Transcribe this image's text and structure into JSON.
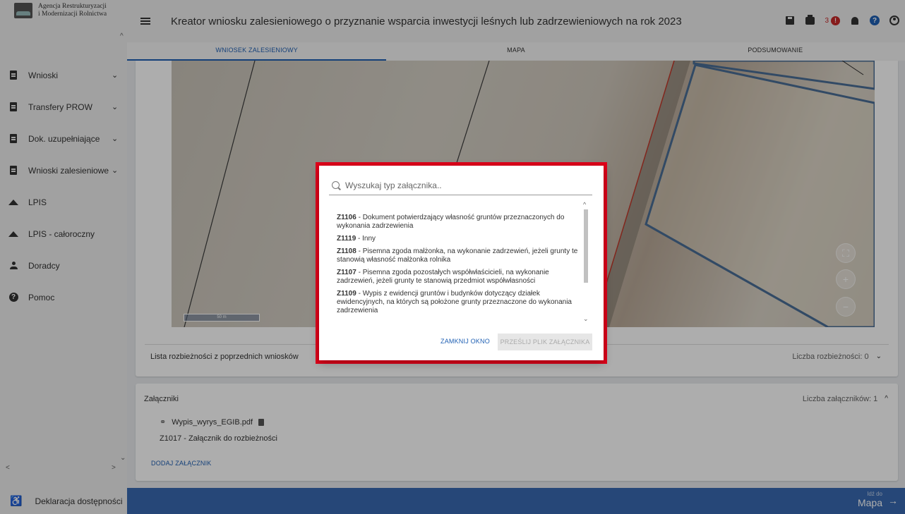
{
  "sidebar": {
    "logo_line1": "Agencja Restrukturyzacji",
    "logo_line2": "i Modernizacji Rolnictwa",
    "items": [
      {
        "label": "Wnioski",
        "icon": "document-icon",
        "expandable": true
      },
      {
        "label": "Transfery PROW",
        "icon": "document-icon",
        "expandable": true
      },
      {
        "label": "Dok. uzupełniające",
        "icon": "document-icon",
        "expandable": true
      },
      {
        "label": "Wnioski zalesieniowe",
        "icon": "document-icon",
        "expandable": true
      },
      {
        "label": "LPIS",
        "icon": "terrain-icon",
        "expandable": false
      },
      {
        "label": "LPIS - całoroczny",
        "icon": "terrain-icon",
        "expandable": false
      },
      {
        "label": "Doradcy",
        "icon": "person-icon",
        "expandable": false
      },
      {
        "label": "Pomoc",
        "icon": "help-icon",
        "expandable": false
      }
    ],
    "accessibility": "Deklaracja dostępności"
  },
  "header": {
    "title": "Kreator wniosku zalesieniowego o przyznanie wsparcia inwestycji leśnych lub zadrzewieniowych na rok 2023",
    "error_count": "3",
    "error_badge": "!",
    "help_glyph": "?"
  },
  "tabs": [
    {
      "label": "WNIOSEK ZALESIENIOWY",
      "active": true
    },
    {
      "label": "MAPA",
      "active": false
    },
    {
      "label": "PODSUMOWANIE",
      "active": false
    }
  ],
  "map": {
    "scale_label": "50 m",
    "fullscreen_glyph": "⛶",
    "zoom_in": "+",
    "zoom_out": "−"
  },
  "discrepancies": {
    "label": "Lista rozbieżności z poprzednich wniosków",
    "count_label": "Liczba rozbieżności: 0"
  },
  "attachments": {
    "heading": "Załączniki",
    "count_label": "Liczba załączników: 1",
    "file_name": "Wypis_wyrys_EGIB.pdf",
    "file_type": "Z1017 - Załącznik do rozbieżności",
    "add_label": "DODAJ ZAŁĄCZNIK"
  },
  "bottom_bar": {
    "goto_small": "Idź do",
    "goto_big": "Mapa"
  },
  "dialog": {
    "search_placeholder": "Wyszukaj typ załącznika..",
    "options": [
      {
        "code": "Z1106",
        "text": " - Dokument potwierdzający własność gruntów przeznaczonych do wykonania zadrzewienia"
      },
      {
        "code": "Z1119",
        "text": " - Inny"
      },
      {
        "code": "Z1108",
        "text": " - Pisemna zgoda małżonka, na wykonanie zadrzewień, jeżeli grunty te stanowią własność małżonka rolnika"
      },
      {
        "code": "Z1107",
        "text": " - Pisemna zgoda pozostałych współwłaścicieli, na wykonanie zadrzewień, jeżeli grunty te stanowią przedmiot współwłasności"
      },
      {
        "code": "Z1109",
        "text": " - Wypis z ewidencji gruntów i budynków dotyczący działek ewidencyjnych, na których są położone grunty przeznaczone do wykonania zadrzewienia"
      }
    ],
    "close_label": "ZAMKNIJ OKNO",
    "send_label": "PRZEŚLIJ PLIK ZAŁĄCZNIKA"
  },
  "colors": {
    "accent": "#1e5fb3",
    "highlight": "#e0001a",
    "bottom_bar": "#3869b1",
    "error": "#c62828"
  }
}
